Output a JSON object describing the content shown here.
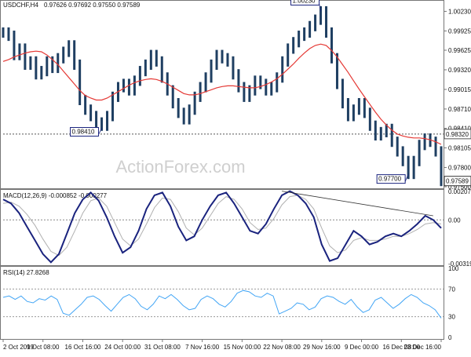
{
  "header": {
    "symbol": "USDCHF,H4",
    "ohlc": "0.97626 0.97692 0.97550 0.97589"
  },
  "watermark": "ActionForex.com",
  "colors": {
    "candles": "#1f3f62",
    "ma": "#e53935",
    "macd": "#1a237e",
    "signal": "#b0b0b0",
    "rsi": "#42a5f5",
    "hline": "#555555"
  },
  "price_panel": {
    "y_ticks": [
      "1.00230",
      "0.99925",
      "0.99625",
      "0.99320",
      "0.99015",
      "0.98710",
      "0.98410",
      "0.98105",
      "0.97800",
      "0.97500"
    ],
    "current_price_label": "0.97589",
    "hline_label": "0.98320",
    "annotations": [
      {
        "text": "1.00230"
      },
      {
        "text": "0.98410"
      },
      {
        "text": "0.97700"
      }
    ]
  },
  "macd_panel": {
    "label": "MACD(12,26,9) -0.000852 -0.000277",
    "y_ticks": [
      "0.002079",
      "0.00",
      "-0.003197"
    ]
  },
  "rsi_panel": {
    "label": "RSI(14) 27.8268",
    "y_ticks": [
      "100",
      "70",
      "30",
      "0"
    ]
  },
  "x_axis": {
    "labels": [
      "2 Oct 2019",
      "9 Oct 08:00",
      "16 Oct 16:00",
      "24 Oct 00:00",
      "31 Oct 08:00",
      "7 Nov 16:00",
      "15 Nov 00:00",
      "22 Nov 08:00",
      "29 Nov 16:00",
      "9 Dec 00:00",
      "16 Dec 08:00",
      "23 Dec 16:00"
    ]
  },
  "chart_data": [
    {
      "type": "line",
      "title": "USDCHF,H4",
      "series": [
        {
          "name": "USDCHF",
          "values": [
            0.999,
            0.9985,
            0.9955,
            0.9965,
            0.994,
            0.9945,
            0.9925,
            0.993,
            0.9945,
            0.9935,
            0.995,
            0.996,
            0.997,
            0.994,
            0.9885,
            0.987,
            0.986,
            0.985,
            0.9845,
            0.986,
            0.989,
            0.9905,
            0.991,
            0.99,
            0.9915,
            0.993,
            0.994,
            0.9955,
            0.9945,
            0.992,
            0.99,
            0.988,
            0.9865,
            0.9855,
            0.987,
            0.989,
            0.9905,
            0.992,
            0.994,
            0.9955,
            0.995,
            0.9945,
            0.9925,
            0.9905,
            0.989,
            0.99,
            0.9915,
            0.991,
            0.99,
            0.9905,
            0.992,
            0.9945,
            0.9965,
            0.9975,
            0.9985,
            0.999,
            1.0,
            1.001,
            1.0023,
            0.999,
            0.995,
            0.991,
            0.988,
            0.986,
            0.987,
            0.988,
            0.9865,
            0.9845,
            0.983,
            0.9835,
            0.984,
            0.982,
            0.9805,
            0.979,
            0.977,
            0.979,
            0.9815,
            0.9825,
            0.982,
            0.9805,
            0.9759
          ]
        },
        {
          "name": "MA",
          "values": [
            0.9945,
            0.9948,
            0.9952,
            0.9955,
            0.9958,
            0.996,
            0.9961,
            0.996,
            0.9955,
            0.9948,
            0.994,
            0.993,
            0.992,
            0.991,
            0.99,
            0.9892,
            0.9888,
            0.9885,
            0.9885,
            0.9888,
            0.9893,
            0.9898,
            0.9903,
            0.9908,
            0.9912,
            0.9915,
            0.9917,
            0.9918,
            0.9917,
            0.9914,
            0.991,
            0.9905,
            0.99,
            0.9895,
            0.9893,
            0.9893,
            0.9895,
            0.9898,
            0.9901,
            0.9904,
            0.9906,
            0.9907,
            0.9907,
            0.9906,
            0.9905,
            0.9904,
            0.9904,
            0.9906,
            0.9909,
            0.9913,
            0.9918,
            0.9925,
            0.9933,
            0.9941,
            0.995,
            0.9958,
            0.9965,
            0.997,
            0.9972,
            0.997,
            0.9962,
            0.9952,
            0.994,
            0.9928,
            0.9915,
            0.9902,
            0.989,
            0.9878,
            0.9866,
            0.9855,
            0.9846,
            0.9838,
            0.9832,
            0.9829,
            0.9827,
            0.9826,
            0.9826,
            0.9825,
            0.9823,
            0.982,
            0.9816
          ]
        }
      ],
      "ylim": [
        0.975,
        1.0026
      ]
    },
    {
      "type": "line",
      "title": "MACD(12,26,9) -0.000852 -0.000277",
      "series": [
        {
          "name": "MACD",
          "values": [
            0.0015,
            0.0012,
            0.0005,
            -0.0005,
            -0.0015,
            -0.0025,
            -0.0031,
            -0.0025,
            -0.001,
            0.0005,
            0.0015,
            0.002,
            0.0014,
            0.0002,
            -0.0012,
            -0.0024,
            -0.002,
            -0.0008,
            0.0008,
            0.0018,
            0.002,
            0.001,
            -0.0005,
            -0.0015,
            -0.0012,
            0.0,
            0.001,
            0.0018,
            0.002,
            0.0012,
            0.0002,
            -0.0008,
            -0.001,
            -0.0003,
            0.0008,
            0.0018,
            0.0021,
            0.0018,
            0.0012,
            0.0002,
            -0.0018,
            -0.003,
            -0.0028,
            -0.0018,
            -0.0008,
            -0.0012,
            -0.0018,
            -0.0016,
            -0.0012,
            -0.001,
            -0.0012,
            -0.0008,
            -0.0003,
            0.0003,
            0.0,
            -0.0006
          ]
        },
        {
          "name": "Signal",
          "values": [
            0.0012,
            0.0013,
            0.001,
            0.0004,
            -0.0004,
            -0.0014,
            -0.0023,
            -0.0026,
            -0.002,
            -0.0008,
            0.0005,
            0.0014,
            0.0016,
            0.001,
            -0.0002,
            -0.0014,
            -0.0019,
            -0.0014,
            -0.0003,
            0.0009,
            0.0016,
            0.0015,
            0.0006,
            -0.0006,
            -0.0011,
            -0.0006,
            0.0003,
            0.0012,
            0.0017,
            0.0015,
            0.0008,
            -0.0002,
            -0.0007,
            -0.0006,
            0.0001,
            0.0011,
            0.0017,
            0.0018,
            0.0015,
            0.0008,
            -0.0006,
            -0.0019,
            -0.0024,
            -0.0022,
            -0.0015,
            -0.0013,
            -0.0015,
            -0.0015,
            -0.0014,
            -0.0012,
            -0.0012,
            -0.001,
            -0.0007,
            -0.0003,
            -0.0002,
            -0.0003
          ]
        }
      ],
      "ylim": [
        -0.003197,
        0.002079
      ]
    },
    {
      "type": "line",
      "title": "RSI(14) 27.8268",
      "series": [
        {
          "name": "RSI",
          "values": [
            58,
            60,
            55,
            60,
            52,
            50,
            56,
            54,
            60,
            55,
            35,
            32,
            40,
            48,
            58,
            60,
            55,
            46,
            38,
            48,
            58,
            62,
            56,
            45,
            40,
            48,
            60,
            56,
            62,
            55,
            46,
            40,
            42,
            55,
            60,
            56,
            48,
            44,
            52,
            64,
            68,
            66,
            60,
            58,
            64,
            60,
            34,
            38,
            42,
            50,
            48,
            40,
            44,
            56,
            60,
            58,
            52,
            48,
            55,
            44,
            36,
            40,
            54,
            58,
            50,
            42,
            48,
            56,
            62,
            58,
            50,
            46,
            40,
            28
          ]
        }
      ],
      "ylim": [
        0,
        100
      ]
    }
  ]
}
